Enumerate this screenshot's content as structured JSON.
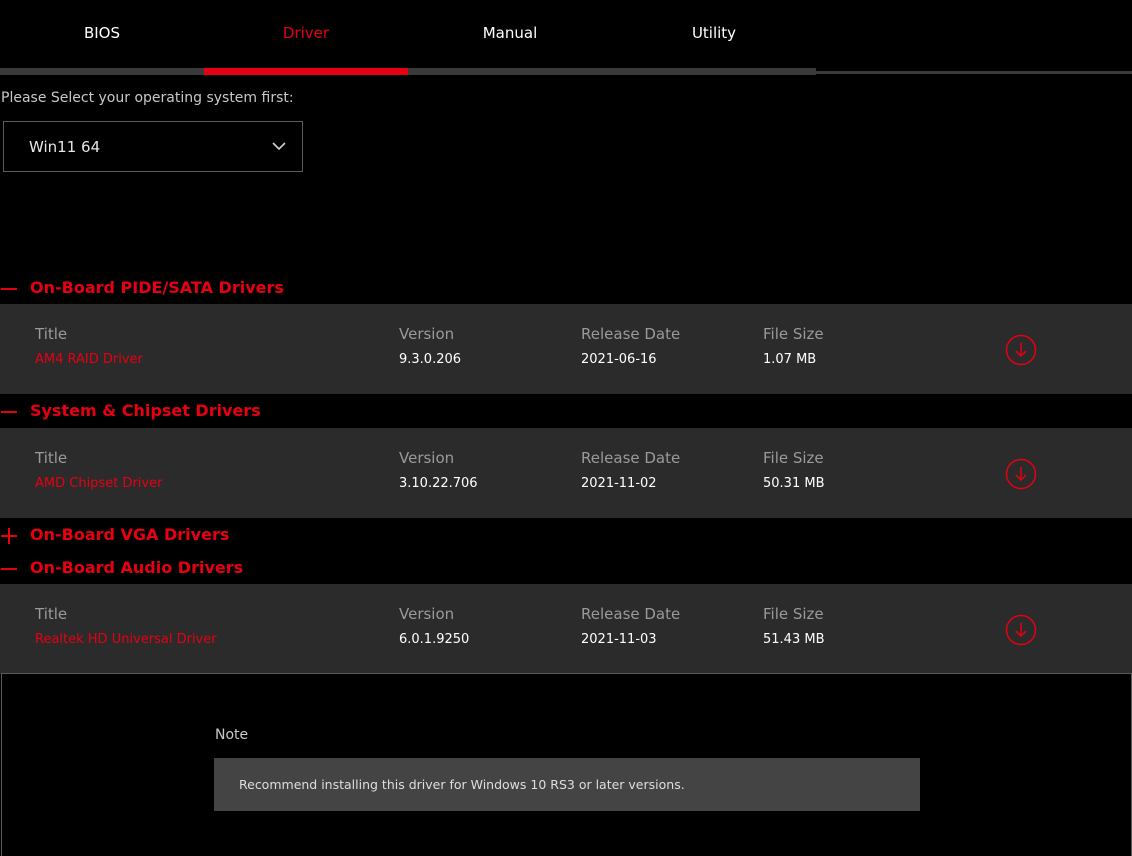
{
  "tabs": [
    {
      "label": "BIOS",
      "active": false
    },
    {
      "label": "Driver",
      "active": true
    },
    {
      "label": "Manual",
      "active": false
    },
    {
      "label": "Utility",
      "active": false
    }
  ],
  "os_prompt": "Please Select your operating system first:",
  "os_select": {
    "value": "Win11 64"
  },
  "columns": {
    "title": "Title",
    "version": "Version",
    "release_date": "Release Date",
    "file_size": "File Size"
  },
  "sections": [
    {
      "title": "On-Board PIDE/SATA Drivers",
      "expanded": true,
      "driver": {
        "title": "AM4 RAID Driver",
        "version": "9.3.0.206",
        "release_date": "2021-06-16",
        "file_size": "1.07 MB"
      }
    },
    {
      "title": "System & Chipset Drivers",
      "expanded": true,
      "driver": {
        "title": "AMD Chipset Driver",
        "version": "3.10.22.706",
        "release_date": "2021-11-02",
        "file_size": "50.31 MB"
      }
    },
    {
      "title": "On-Board VGA Drivers",
      "expanded": false
    },
    {
      "title": "On-Board Audio Drivers",
      "expanded": true,
      "driver": {
        "title": "Realtek HD Universal Driver",
        "version": "6.0.1.9250",
        "release_date": "2021-11-03",
        "file_size": "51.43 MB"
      }
    }
  ],
  "note": {
    "label": "Note",
    "text": "Recommend installing this driver for Windows 10 RS3 or later versions."
  },
  "colors": {
    "accent": "#e60012",
    "row_bg": "#2b2b2b",
    "background": "#000000"
  },
  "icons": {
    "collapse": "minus-icon",
    "expand": "plus-icon",
    "download": "download-icon",
    "dropdown": "chevron-down-icon"
  }
}
